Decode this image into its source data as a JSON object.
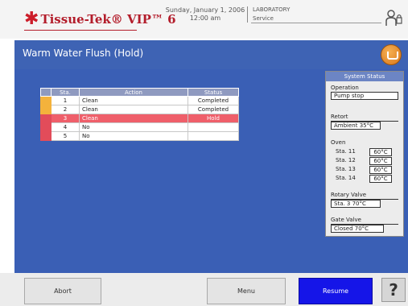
{
  "header": {
    "brand": "Tissue-Tek® VIP™ 6",
    "date": "Sunday, January 1, 2006",
    "time": "12:00 am",
    "lab_name": "LABORATORY",
    "user": "Service"
  },
  "titlebar": {
    "title": "Warm Water Flush (Hold)"
  },
  "table": {
    "headers": [
      "Sta.",
      "Action",
      "Status"
    ],
    "rows": [
      {
        "sta": "1",
        "action": "Clean",
        "status": "Completed",
        "marker": "orange"
      },
      {
        "sta": "2",
        "action": "Clean",
        "status": "Completed",
        "marker": "orange"
      },
      {
        "sta": "3",
        "action": "Clean",
        "status": "Hold",
        "marker": "red"
      },
      {
        "sta": "4",
        "action": "No",
        "status": "",
        "marker": "red"
      },
      {
        "sta": "5",
        "action": "No",
        "status": "",
        "marker": "red"
      }
    ]
  },
  "system_status": {
    "title": "System Status",
    "operation_label": "Operation",
    "operation_value": "Pump stop",
    "retort_label": "Retort",
    "retort_value": "Ambient 35°C",
    "oven_label": "Oven",
    "oven": [
      {
        "label": "Sta. 11",
        "value": "60°C"
      },
      {
        "label": "Sta. 12",
        "value": "60°C"
      },
      {
        "label": "Sta. 13",
        "value": "60°C"
      },
      {
        "label": "Sta. 14",
        "value": "60°C"
      }
    ],
    "rotary_label": "Rotary Valve",
    "rotary_value": "Sta. 3 70°C",
    "gate_label": "Gate Valve",
    "gate_value": "Closed 70°C"
  },
  "footer": {
    "abort": "Abort",
    "menu": "Menu",
    "resume": "Resume",
    "help": "?"
  },
  "colors": {
    "accent_blue": "#3e63b4",
    "resume_blue": "#1515e8",
    "hold_red": "#ef5f6a",
    "completed_marker": "#f4b23c",
    "brand_red": "#b31d2b"
  }
}
